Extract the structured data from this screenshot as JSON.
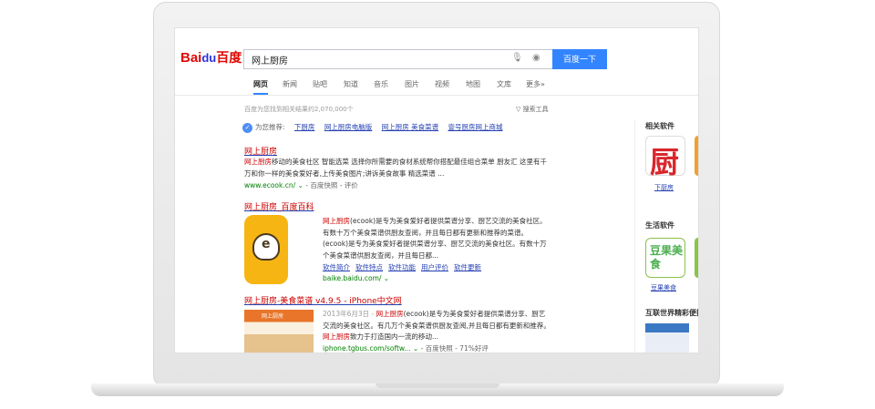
{
  "browser": {
    "logo_text": "Bai",
    "logo_paw": "du",
    "logo_cn": "百度",
    "search_value": "网上厨房",
    "search_button": "百度一下",
    "nav": [
      "网页",
      "新闻",
      "贴吧",
      "知道",
      "音乐",
      "图片",
      "视频",
      "地图",
      "文库",
      "更多»"
    ],
    "result_count": "百度为您找到相关结果约2,070,000个",
    "tools": "搜索工具",
    "recommend_label": "为您推荐:",
    "recommend_links": [
      "下厨房",
      "网上厨房电脑版",
      "网上厨房 美食菜谱",
      "壹号厨房网上商城"
    ]
  },
  "results": [
    {
      "title": "网上厨房",
      "text_hl": "网上厨房",
      "text": "移动的美食社区 智能选菜 选择你所需要的食材系统帮你搭配最佳组合菜单 厨友汇 这里有千万和你一样的美食爱好者,上传美食图片;讲诉美食故事 精选菜谱 ...",
      "url": "www.ecook.cn/",
      "meta": " - 百度快照 - 评价"
    },
    {
      "title": "网上厨房_百度百科",
      "text_hl": "网上厨房",
      "text": "(ecook)是专为美食爱好者提供菜谱分享、厨艺交流的美食社区。有数十万个美食菜谱供厨友查阅，并且每日都有更新和推荐的菜谱。(ecook)是专为美食爱好者提供菜谱分享、厨艺交流的美食社区。有数十万个美食菜谱供厨友查阅，并且每日都...",
      "links": [
        "软件简介",
        "软件特点",
        "软件功能",
        "用户评价",
        "软件更新"
      ],
      "url": "baike.baidu.com/",
      "app_letter": "e"
    },
    {
      "title": "网上厨房-美食菜谱 v4.9.5 - iPhone中文网",
      "date": "2013年6月3日 - ",
      "text_hl": "网上厨房",
      "text": "(ecook)是专为美食爱好者提供菜谱分享、厨艺交流的美食社区。有几万个美食菜谱供厨友查阅,并且每日都有更新和推荐。",
      "text_tail": "致力于打造国内一流的移动...",
      "url": "iphone.tgbus.com/softw...",
      "meta": " - 百度快照 - 71%好评",
      "thumb_label": "网上厨房"
    }
  ],
  "sidebar": {
    "related_title": "相关软件",
    "related_item": "下厨房",
    "related_icon_char": "厨",
    "life_title": "生活软件",
    "life_item": "豆果美食",
    "life_icon_text": "豆果美食",
    "internet_title": "互联世界精彩便捷"
  }
}
